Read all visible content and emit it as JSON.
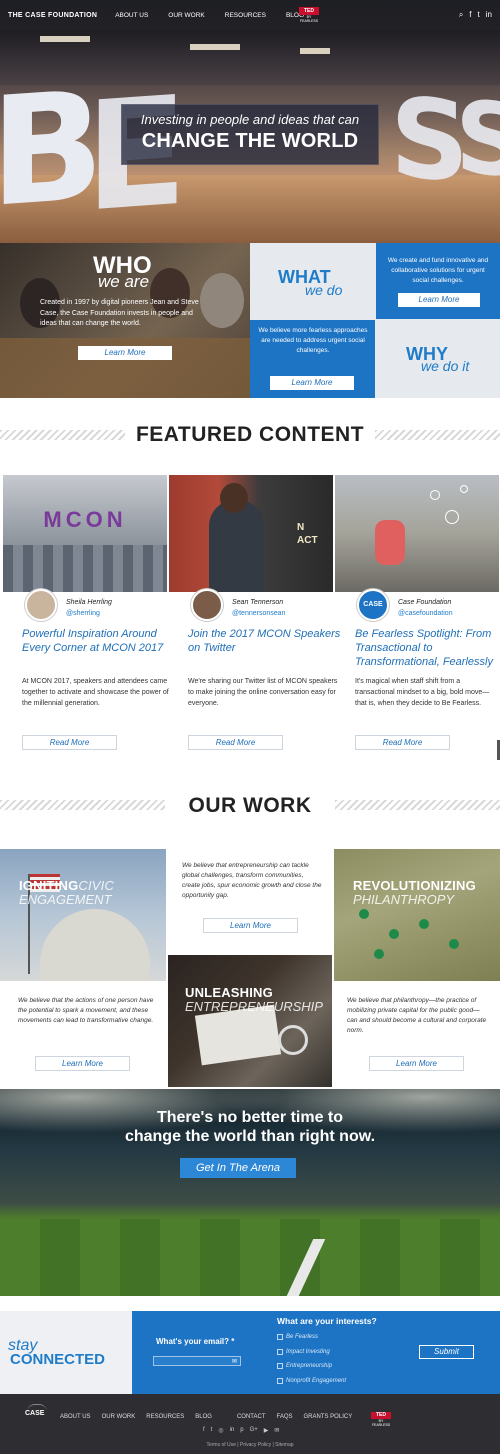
{
  "nav": {
    "logo": "THE CASE FOUNDATION",
    "items": [
      "ABOUT US",
      "OUR WORK",
      "RESOURCES",
      "BLOG"
    ],
    "ted_logo": "TED",
    "ted_sub": "BY FEARLESS",
    "icons": [
      "search-icon",
      "facebook-icon",
      "twitter-icon",
      "linkedin-icon"
    ]
  },
  "hero": {
    "letters": "BE FEARLESS",
    "tagline": "Investing in people and ideas that can",
    "headline": "CHANGE THE WORLD"
  },
  "who": {
    "title": "WHO",
    "subtitle": "we are",
    "text": "Created in 1997 by digital pioneers Jean and Steve Case, the Case Foundation invests in people and ideas that can change the world.",
    "button": "Learn More"
  },
  "what": {
    "title": "WHAT",
    "subtitle": "we do",
    "text": "We create and fund innovative and collaborative solutions for urgent social challenges.",
    "button": "Learn More"
  },
  "why": {
    "title": "WHY",
    "subtitle": "we do it",
    "text": "We believe more fearless approaches are needed to address urgent social challenges.",
    "button": "Learn More"
  },
  "featured": {
    "title": "FEATURED CONTENT",
    "cards": [
      {
        "name": "Sheila Herrling",
        "handle": "@sherrling",
        "title": "Powerful Inspiration Around Every Corner at MCON 2017",
        "text": "At MCON 2017, speakers and attendees came together to activate and showcase the power of the millennial generation.",
        "button": "Read More",
        "image_label": "MCON"
      },
      {
        "name": "Sean Tennerson",
        "handle": "@tennersonsean",
        "title": "Join the 2017 MCON Speakers on Twitter",
        "text": "We're sharing our Twitter list of MCON speakers to make joining the online conversation easy for everyone.",
        "button": "Read More",
        "image_label": "N\nACT"
      },
      {
        "name": "Case Foundation",
        "handle": "@casefoundation",
        "title": "Be Fearless Spotlight: From Transactional to Transformational, Fearlessly",
        "text": "It's magical when staff shift from a transactional mindset to a big, bold move—that is, when they decide to Be Fearless.",
        "button": "Read More",
        "avatar_label": "CASE"
      }
    ]
  },
  "our_work": {
    "title": "OUR WORK",
    "civic": {
      "title": "IGNITING",
      "title_thin": "CIVIC",
      "subtitle": "ENGAGEMENT",
      "text": "We believe that the actions of one person have the potential to spark a movement, and these movements can lead to transformative change.",
      "button": "Learn More"
    },
    "entre": {
      "text": "We believe that entrepreneurship can tackle global challenges, transform communities, create jobs, spur economic growth and close the opportunity gap.",
      "button": "Learn More",
      "title": "UNLEASHING",
      "subtitle": "ENTREPRENEURSHIP"
    },
    "phil": {
      "title": "REVOLUTIONIZING",
      "subtitle": "PHILANTHROPY",
      "text": "We believe that philanthropy—the practice of mobilizing private capital for the public good—can and should become a cultural and corporate norm.",
      "button": "Learn More"
    }
  },
  "arena": {
    "line1": "There's no better time to",
    "line2": "change the world than right now.",
    "button": "Get In The Arena"
  },
  "stay": {
    "line1": "stay",
    "line2": "CONNECTED",
    "email_label": "What's your email? *",
    "email_value": "",
    "interests_title": "What are your interests?",
    "interests": [
      "Be Fearless",
      "Impact Investing",
      "Entrepreneurship",
      "Nonprofit Engagement"
    ],
    "submit": "Submit"
  },
  "footer": {
    "logo": "CASE",
    "items": [
      "ABOUT US",
      "OUR WORK",
      "RESOURCES",
      "BLOG",
      "CONTACT",
      "FAQS",
      "GRANTS POLICY"
    ],
    "ted_logo": "TED",
    "ted_sub": "BY FEARLESS",
    "icons": [
      "facebook-icon",
      "twitter-icon",
      "instagram-icon",
      "linkedin-icon",
      "pinterest-icon",
      "google-plus-icon",
      "youtube-icon",
      "email-icon"
    ],
    "links": "Terms of Use | Privacy Policy | Sitemap"
  },
  "colors": {
    "accent_blue": "#1e74c4",
    "dark": "#2e2e32"
  }
}
